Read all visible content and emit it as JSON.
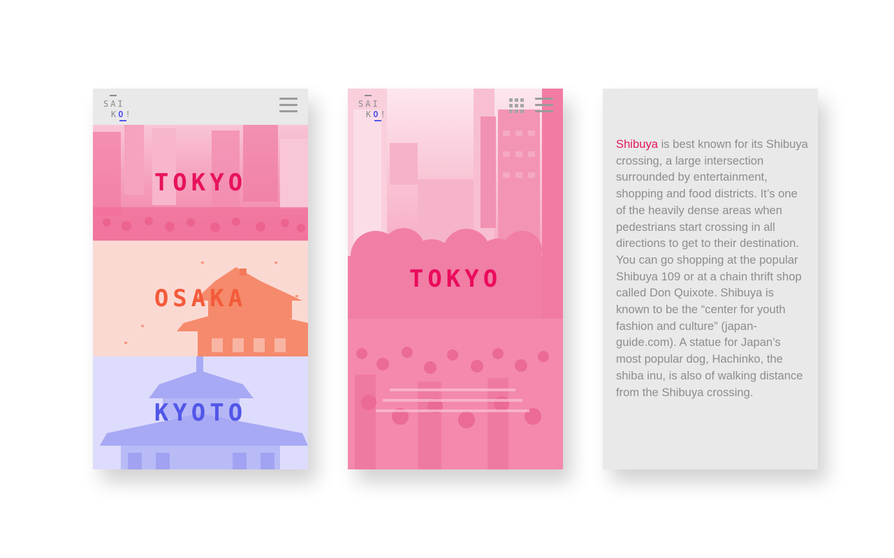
{
  "logo": {
    "line1": "SAI",
    "line2_prefix": "K",
    "line2_o": "O",
    "line2_suffix": "!"
  },
  "colors": {
    "tokyo": "#e8125c",
    "osaka": "#f35b3a",
    "kyoto": "#5156e8",
    "highlight": "#e3175a",
    "icon_gray": "#9b9b9b"
  },
  "screen1": {
    "menu_icon": "hamburger-menu-icon",
    "cities": [
      {
        "label": "TOKYO"
      },
      {
        "label": "OSAKA"
      },
      {
        "label": "KYOTO"
      }
    ]
  },
  "screen2": {
    "title": "TOKYO",
    "grid_icon": "grid-view-icon",
    "menu_icon": "hamburger-menu-icon"
  },
  "screen3": {
    "highlight": "Shibuya",
    "body": " is best known for its Shibuya crossing, a large intersection surrounded by entertainment, shopping and food districts. It’s one of the heavily dense areas when pedestrians start crossing in all directions to get to their destination. You can go shopping at the popular Shibuya 109 or at a chain thrift shop called Don Quixote. Shibuya is known to be the “center for youth fashion and culture” (japan-guide.com). A statue for Japan’s most popular dog, Hachinko, the shiba inu, is also of walking distance from the Shibuya crossing."
  }
}
